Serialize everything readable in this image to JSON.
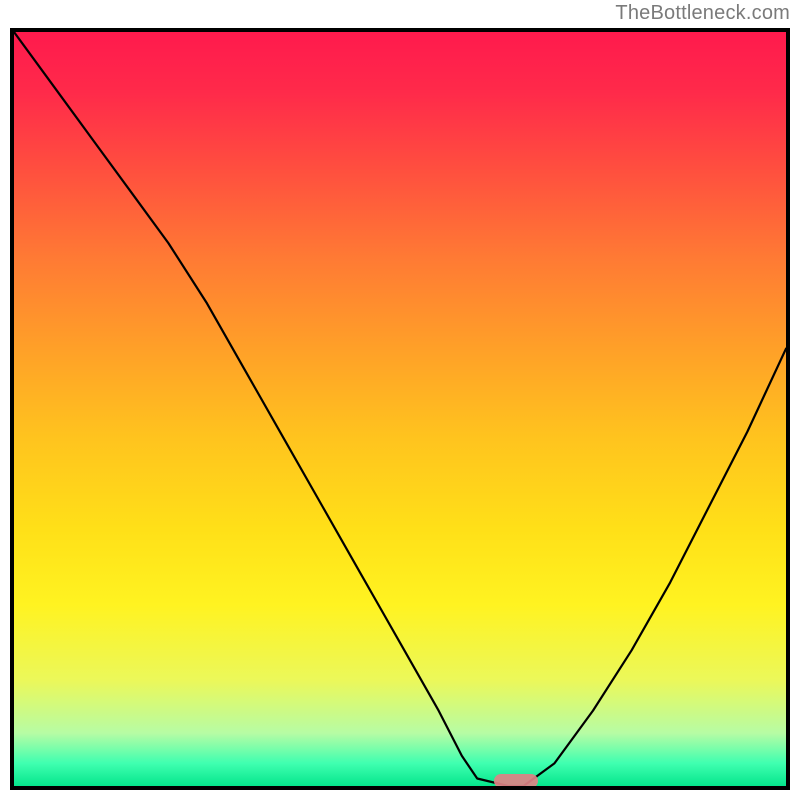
{
  "attribution": "TheBottleneck.com",
  "colors": {
    "top": "#ff1a4d",
    "mid_upper": "#ff7a34",
    "mid": "#ffe018",
    "mid_lower": "#b6fca4",
    "bottom": "#05e68c",
    "curve": "#000000",
    "marker": "#e08286",
    "frame": "#000000"
  },
  "chart_data": {
    "type": "line",
    "title": "",
    "xlabel": "",
    "ylabel": "",
    "xlim": [
      0,
      100
    ],
    "ylim": [
      0,
      100
    ],
    "grid": false,
    "legend": false,
    "x": [
      0,
      5,
      10,
      15,
      20,
      25,
      30,
      35,
      40,
      45,
      50,
      55,
      58,
      60,
      64,
      66,
      70,
      75,
      80,
      85,
      90,
      95,
      100
    ],
    "values": [
      100,
      93,
      86,
      79,
      72,
      64,
      55,
      46,
      37,
      28,
      19,
      10,
      4,
      1,
      0,
      0,
      3,
      10,
      18,
      27,
      37,
      47,
      58
    ],
    "series": [
      {
        "name": "bottleneck-curve",
        "values": [
          100,
          93,
          86,
          79,
          72,
          64,
          55,
          46,
          37,
          28,
          19,
          10,
          4,
          1,
          0,
          0,
          3,
          10,
          18,
          27,
          37,
          47,
          58
        ]
      }
    ],
    "minimum": {
      "x": 65,
      "y": 0
    },
    "annotations": [
      {
        "kind": "pill-marker",
        "x": 65,
        "y": 0.6
      }
    ]
  }
}
